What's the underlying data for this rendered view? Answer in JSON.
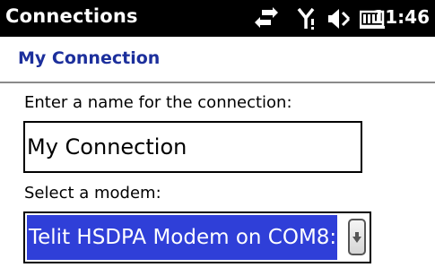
{
  "statusbar": {
    "app_title": "Connections",
    "time": "11:46",
    "icons": [
      "connectivity-arrows-icon",
      "signal-antenna-icon",
      "speaker-muted-icon",
      "battery-icon"
    ]
  },
  "page": {
    "heading": "My Connection"
  },
  "form": {
    "name_label": "Enter a name for the connection:",
    "name_value": "My Connection",
    "modem_label": "Select a modem:",
    "modem_value": "Telit HSDPA Modem on COM8:"
  },
  "colors": {
    "titlebar_bg": "#000000",
    "heading_text": "#1c2f9c",
    "selection_bg": "#2f3fd8"
  }
}
